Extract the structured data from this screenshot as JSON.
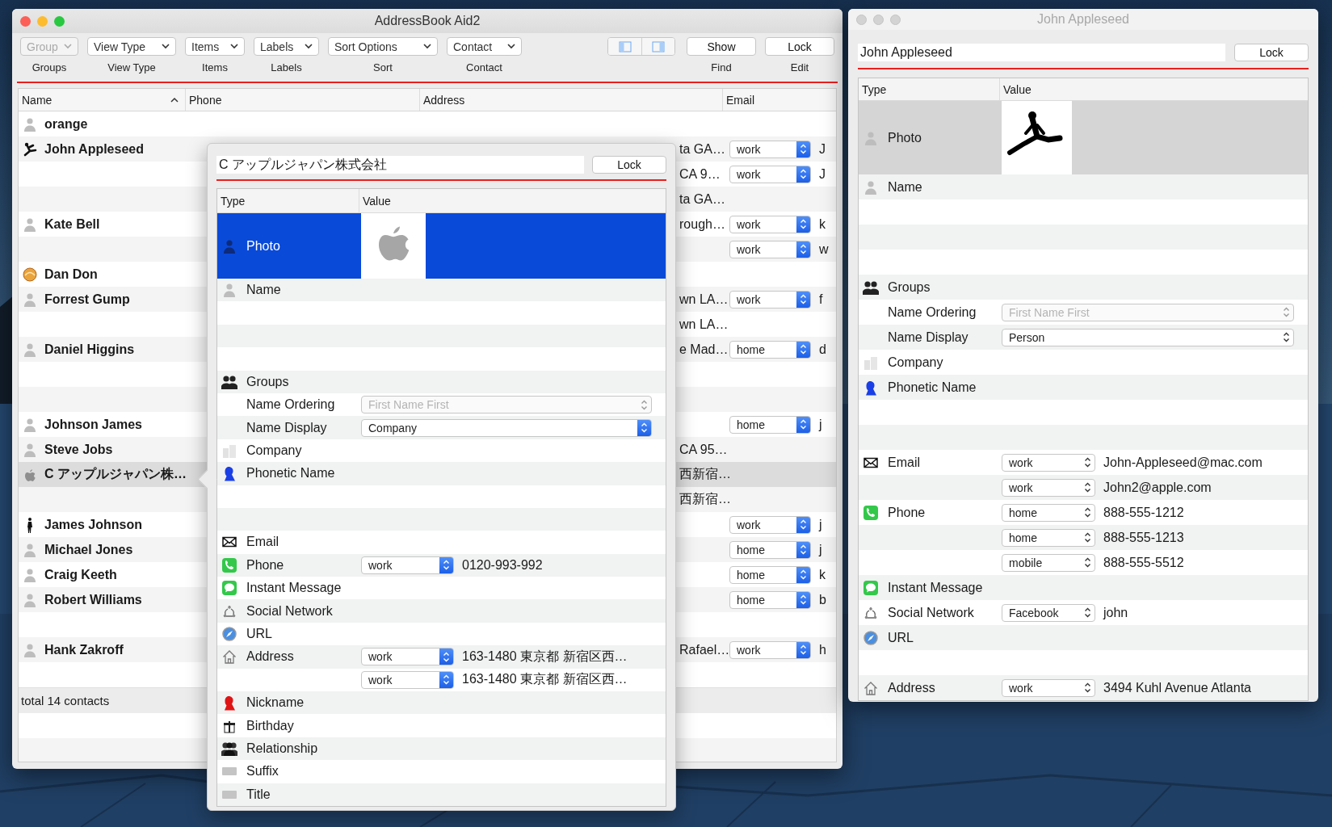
{
  "main_window": {
    "title": "AddressBook Aid2",
    "toolbar": {
      "popups": [
        {
          "value": "Group",
          "label": "Groups",
          "disabled": true
        },
        {
          "value": "View Type",
          "label": "View Type",
          "disabled": false
        },
        {
          "value": "Items",
          "label": "Items",
          "disabled": false
        },
        {
          "value": "Labels",
          "label": "Labels",
          "disabled": false
        },
        {
          "value": "Sort Options",
          "label": "Sort",
          "disabled": false
        },
        {
          "value": "Contact",
          "label": "Contact",
          "disabled": false
        }
      ],
      "buttons": [
        {
          "text": "Show",
          "label": "Find"
        },
        {
          "text": "Lock",
          "label": "Edit"
        }
      ]
    },
    "table": {
      "columns": [
        "Name",
        "Phone",
        "Address",
        "Email"
      ],
      "rows": [
        {
          "selected": false,
          "name": "orange"
        },
        {
          "selected": false,
          "name": "John Appleseed",
          "address": "ta GA…",
          "email": {
            "label": "work",
            "text": "J"
          }
        },
        {
          "selected": false,
          "address": "CA 9…",
          "email": {
            "label": "work",
            "text": "J"
          }
        },
        {
          "selected": false,
          "address": "ta GA…"
        },
        {
          "selected": false,
          "name": "Kate Bell",
          "address": "rough…",
          "email": {
            "label": "work",
            "text": "k"
          }
        },
        {
          "selected": false,
          "email": {
            "label": "work",
            "text": "w"
          }
        },
        {
          "selected": false,
          "name": "Dan Don"
        },
        {
          "selected": false,
          "name": "Forrest Gump",
          "address": "wn LA…",
          "email": {
            "label": "work",
            "text": "f"
          }
        },
        {
          "selected": false,
          "address": "wn LA…"
        },
        {
          "selected": false,
          "name": "Daniel Higgins",
          "address": "e Mad…",
          "email": {
            "label": "home",
            "text": "d"
          }
        },
        {
          "selected": false
        },
        {
          "selected": false
        },
        {
          "selected": false,
          "name": "Johnson James",
          "email": {
            "label": "home",
            "text": "j"
          }
        },
        {
          "selected": false,
          "name": "Steve Jobs",
          "address": "CA 95…"
        },
        {
          "selected": true,
          "name": "C アップルジャパン株…",
          "address": "西新宿…"
        },
        {
          "selected": false,
          "address": "西新宿…"
        },
        {
          "selected": false,
          "name": "James Johnson",
          "email": {
            "label": "work",
            "text": "j"
          }
        },
        {
          "selected": false,
          "name": "Michael Jones",
          "email": {
            "label": "home",
            "text": "j"
          }
        },
        {
          "selected": false,
          "name": "Craig Keeth",
          "email": {
            "label": "home",
            "text": "k"
          }
        },
        {
          "selected": false,
          "name": "Robert Williams",
          "email": {
            "label": "home",
            "text": "b"
          }
        },
        {
          "selected": false
        },
        {
          "selected": false,
          "name": "Hank Zakroff",
          "address": "Rafael…",
          "email": {
            "label": "work",
            "text": "h"
          }
        },
        {
          "selected": false
        }
      ],
      "status": "total 14 contacts"
    }
  },
  "popover": {
    "name": "C アップルジャパン株式会社",
    "lock": "Lock",
    "columns": [
      "Type",
      "Value"
    ],
    "rows": [
      {
        "label": "Photo",
        "selected": true
      },
      {
        "kind": "plain",
        "label": "Name",
        "selected": false
      },
      {
        "kind": "plain",
        "selected": false
      },
      {
        "kind": "plain",
        "selected": false
      },
      {
        "kind": "plain",
        "selected": false
      },
      {
        "kind": "plain",
        "label": "Groups",
        "selected": false
      },
      {
        "kind": "select",
        "label": "Name Ordering",
        "selected": false,
        "popup": {
          "value": "First Name First",
          "disabled": true
        }
      },
      {
        "kind": "select",
        "label": "Name Display",
        "selected": false,
        "popup": {
          "value": "Company",
          "disabled": false
        }
      },
      {
        "kind": "plain",
        "label": "Company",
        "selected": false
      },
      {
        "kind": "plain",
        "label": "Phonetic Name",
        "selected": false
      },
      {
        "kind": "plain",
        "selected": false
      },
      {
        "kind": "plain",
        "selected": false
      },
      {
        "kind": "plain",
        "label": "Email",
        "selected": false
      },
      {
        "kind": "entry",
        "label": "Phone",
        "selected": false,
        "popup": {
          "value": "work",
          "disabled": false
        },
        "value": "0120-993-992"
      },
      {
        "kind": "plain",
        "label": "Instant Message",
        "selected": false
      },
      {
        "kind": "plain",
        "label": "Social Network",
        "selected": false
      },
      {
        "kind": "plain",
        "label": "URL",
        "selected": false
      },
      {
        "kind": "entry",
        "label": "Address",
        "selected": false,
        "popup": {
          "value": "work",
          "disabled": false
        },
        "value": "163-1480 東京都 新宿区西…"
      },
      {
        "kind": "entry",
        "selected": false,
        "popup": {
          "value": "work",
          "disabled": false
        },
        "value": "163-1480 東京都 新宿区西…"
      },
      {
        "kind": "plain",
        "label": "Nickname",
        "selected": false
      },
      {
        "kind": "plain",
        "label": "Birthday",
        "selected": false
      },
      {
        "kind": "plain",
        "label": "Relationship",
        "selected": false
      },
      {
        "kind": "plain",
        "label": "Suffix",
        "selected": false
      },
      {
        "kind": "plain",
        "label": "Title",
        "selected": false
      }
    ]
  },
  "inspector": {
    "title": "John Appleseed",
    "name": "John Appleseed",
    "lock": "Lock",
    "columns": [
      "Type",
      "Value"
    ],
    "rows": [
      {
        "label": "Photo",
        "selected": true
      },
      {
        "kind": "plain",
        "label": "Name",
        "selected": false
      },
      {
        "kind": "plain",
        "selected": false
      },
      {
        "kind": "plain",
        "selected": false
      },
      {
        "kind": "plain",
        "selected": false
      },
      {
        "kind": "plain",
        "label": "Groups",
        "selected": false
      },
      {
        "kind": "select",
        "label": "Name Ordering",
        "selected": false,
        "popup": {
          "value": "First Name First",
          "disabled": true
        }
      },
      {
        "kind": "select",
        "label": "Name Display",
        "selected": false,
        "popup": {
          "value": "Person",
          "disabled": false
        }
      },
      {
        "kind": "plain",
        "label": "Company",
        "selected": false
      },
      {
        "kind": "plain",
        "label": "Phonetic Name",
        "selected": false
      },
      {
        "kind": "plain",
        "selected": false
      },
      {
        "kind": "plain",
        "selected": false
      },
      {
        "kind": "entry",
        "label": "Email",
        "selected": false,
        "popup": {
          "value": "work",
          "disabled": false
        },
        "value": "John-Appleseed@mac.com"
      },
      {
        "kind": "entry",
        "selected": false,
        "popup": {
          "value": "work",
          "disabled": false
        },
        "value": "John2@apple.com"
      },
      {
        "kind": "entry",
        "label": "Phone",
        "selected": false,
        "popup": {
          "value": "home",
          "disabled": false
        },
        "value": "888-555-1212"
      },
      {
        "kind": "entry",
        "selected": false,
        "popup": {
          "value": "home",
          "disabled": false
        },
        "value": "888-555-1213"
      },
      {
        "kind": "entry",
        "selected": false,
        "popup": {
          "value": "mobile",
          "disabled": false
        },
        "value": "888-555-5512"
      },
      {
        "kind": "plain",
        "label": "Instant Message",
        "selected": false
      },
      {
        "kind": "entry",
        "label": "Social Network",
        "selected": false,
        "popup": {
          "value": "Facebook",
          "disabled": false
        },
        "value": "john"
      },
      {
        "kind": "plain",
        "label": "URL",
        "selected": false
      },
      {
        "kind": "plain",
        "selected": false
      },
      {
        "kind": "entry",
        "label": "Address",
        "selected": false,
        "popup": {
          "value": "work",
          "disabled": false
        },
        "value": "3494 Kuhl Avenue Atlanta"
      }
    ]
  }
}
